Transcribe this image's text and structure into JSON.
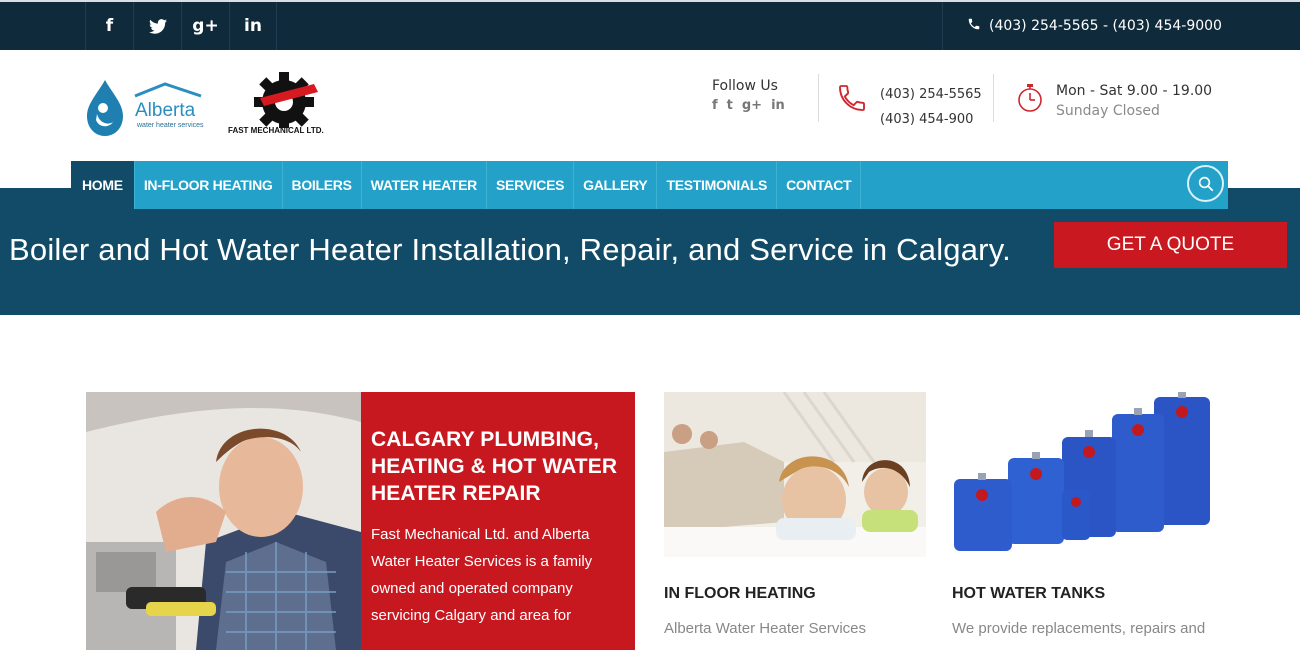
{
  "topbar": {
    "social": [
      {
        "icon": "facebook-icon",
        "glyph": "f"
      },
      {
        "icon": "twitter-icon",
        "glyph": "t"
      },
      {
        "icon": "google-plus-icon",
        "glyph": "g+"
      },
      {
        "icon": "linkedin-icon",
        "glyph": "in"
      }
    ],
    "phone": "(403) 254-5565 - (403) 454-9000"
  },
  "header": {
    "logo1": {
      "name": "Alberta",
      "tagline": "water heater services"
    },
    "logo2": {
      "name": "FAST MECHANICAL LTD."
    },
    "follow_label": "Follow Us",
    "follow_icons": [
      "f",
      "t",
      "g+",
      "in"
    ],
    "phone1": "(403) 254-5565",
    "phone2": "(403) 454-900",
    "hours1": "Mon - Sat 9.00 - 19.00",
    "hours2": "Sunday Closed"
  },
  "nav": {
    "items": [
      "HOME",
      "IN-FLOOR HEATING",
      "BOILERS",
      "WATER HEATER",
      "SERVICES",
      "GALLERY",
      "TESTIMONIALS",
      "CONTACT"
    ],
    "active": "HOME"
  },
  "hero": {
    "tagline": "Boiler and Hot Water Heater Installation, Repair, and Service in Calgary.",
    "quote_button": "GET A QUOTE"
  },
  "feature": {
    "title": "CALGARY PLUMBING, HEATING & HOT WATER HEATER REPAIR",
    "body": "Fast Mechanical Ltd. and Alberta Water Heater Services is a family owned and operated company servicing Calgary and area for"
  },
  "cards": [
    {
      "title": "IN FLOOR HEATING",
      "body": "Alberta Water Heater Services"
    },
    {
      "title": "HOT WATER TANKS",
      "body": "We provide replacements, repairs and"
    }
  ],
  "colors": {
    "topbar": "#0f2a3b",
    "nav": "#24a1c9",
    "band": "#114b68",
    "accent_red": "#c71820"
  }
}
